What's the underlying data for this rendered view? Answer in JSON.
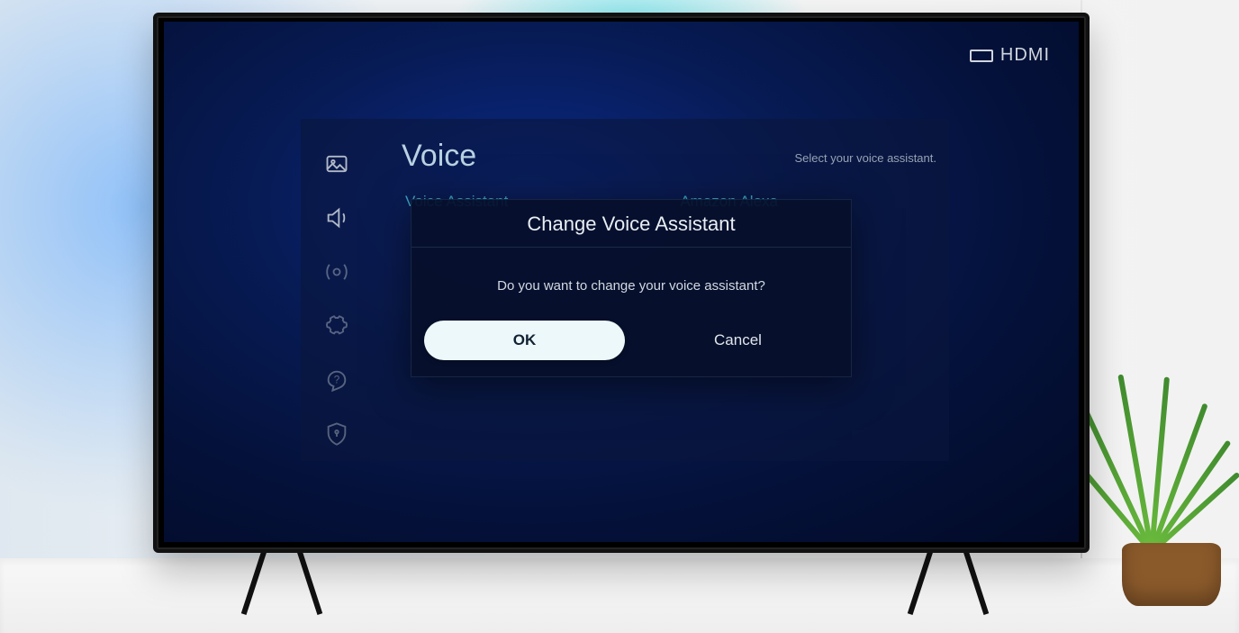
{
  "status": {
    "input_label": "HDMI"
  },
  "panel": {
    "title": "Voice",
    "hint": "Select your voice assistant.",
    "row_label": "Voice Assistant",
    "row_value": "Amazon Alexa"
  },
  "rail": {
    "items": [
      {
        "name": "picture-icon"
      },
      {
        "name": "sound-icon"
      },
      {
        "name": "broadcast-icon"
      },
      {
        "name": "general-icon"
      },
      {
        "name": "support-icon"
      },
      {
        "name": "privacy-icon"
      }
    ]
  },
  "dialog": {
    "title": "Change Voice Assistant",
    "message": "Do you want to change your voice assistant?",
    "ok_label": "OK",
    "cancel_label": "Cancel"
  }
}
